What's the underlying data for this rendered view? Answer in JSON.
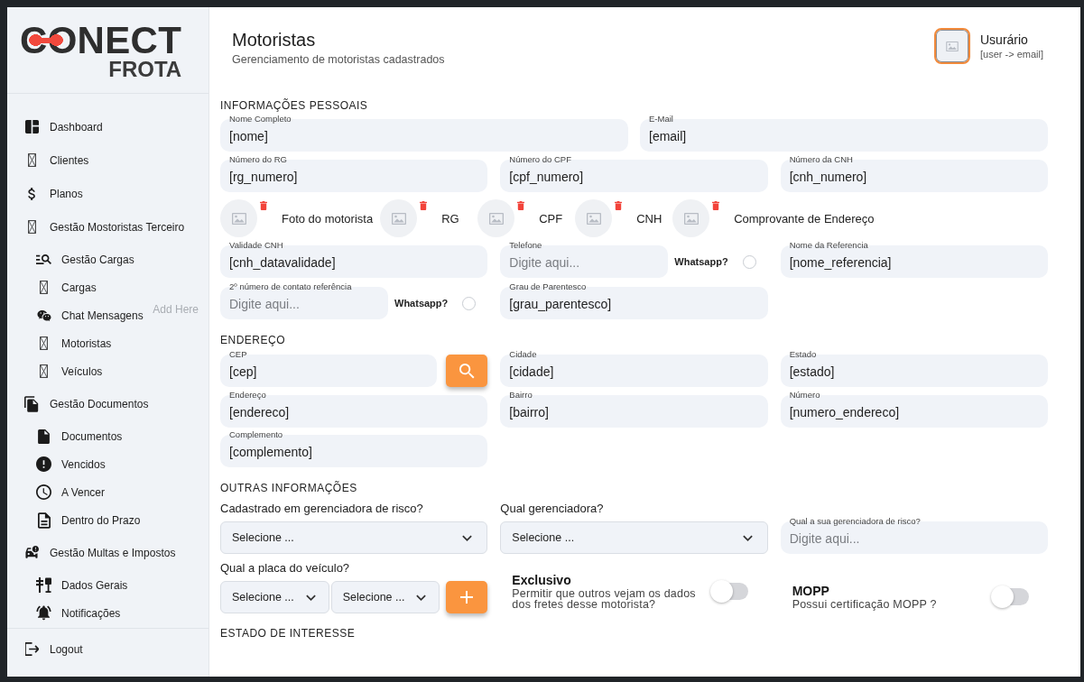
{
  "sidebar": {
    "logo": {
      "wordmark": "CONECT",
      "tagline": "FROTA"
    },
    "menu": [
      {
        "label": "Dashboard"
      },
      {
        "label": "Clientes"
      },
      {
        "label": "Planos"
      },
      {
        "label": "Gestão Mostoristas Terceiro",
        "children": [
          {
            "label": "Gestão Cargas"
          },
          {
            "label": "Cargas"
          },
          {
            "label": "Chat Mensagens",
            "note": "Add Here"
          },
          {
            "label": "Motoristas"
          },
          {
            "label": "Veículos"
          }
        ]
      },
      {
        "label": "Gestão Documentos",
        "children": [
          {
            "label": "Documentos"
          },
          {
            "label": "Vencidos"
          },
          {
            "label": "A Vencer"
          },
          {
            "label": "Dentro do Prazo"
          }
        ]
      },
      {
        "label": "Gestão Multas e Impostos",
        "children": [
          {
            "label": "Dados Gerais"
          },
          {
            "label": "Notificações"
          }
        ]
      }
    ],
    "logout": "Logout"
  },
  "header": {
    "title": "Motoristas",
    "subtitle": "Gerenciamento de motoristas cadastrados",
    "user": {
      "name": "Usurário",
      "email": "[user -> email]"
    }
  },
  "personal": {
    "heading": "INFORMAÇÕES PESSOAIS",
    "name_fields": [
      {
        "label": "Nome Completo",
        "value": "[nome]"
      },
      {
        "label": "E-Mail",
        "value": "[email]"
      }
    ],
    "id_fields": [
      {
        "label": "Número do RG",
        "value": "[rg_numero]"
      },
      {
        "label": "Número do CPF",
        "value": "[cpf_numero]"
      },
      {
        "label": "Número da CNH",
        "value": "[cnh_numero]"
      }
    ],
    "documents": [
      {
        "label": "Foto do motorista"
      },
      {
        "label": "RG"
      },
      {
        "label": "CPF"
      },
      {
        "label": "CNH"
      },
      {
        "label": "Comprovante de Endereço"
      }
    ],
    "validity": {
      "label": "Validade CNH",
      "value": "[cnh_datavalidade]"
    },
    "phone": {
      "label": "Telefone",
      "placeholder": "Digite aqui...",
      "whatsapp": {
        "label": "Whatsapp?",
        "checked": false
      }
    },
    "reference_name": {
      "label": "Nome da Referencia",
      "value": "[nome_referencia]"
    },
    "reference_phone": {
      "label": "2º número de contato referência",
      "placeholder": "Digite aqui...",
      "whatsapp": {
        "label": "Whatsapp?",
        "checked": false
      }
    },
    "kinship": {
      "label": "Grau de Parentesco",
      "value": "[grau_parentesco]"
    }
  },
  "address": {
    "heading": "ENDEREÇO",
    "cep": {
      "label": "CEP",
      "value": "[cep]"
    },
    "fields": [
      {
        "label": "Cidade",
        "value": "[cidade]"
      },
      {
        "label": "Estado",
        "value": "[estado]"
      },
      {
        "label": "Endereço",
        "value": "[endereco]"
      },
      {
        "label": "Bairro",
        "value": "[bairro]"
      },
      {
        "label": "Número",
        "value": "[numero_endereco]"
      },
      {
        "label": "Complemento",
        "value": "[complemento]"
      }
    ]
  },
  "other": {
    "heading": "OUTRAS INFORMAÇÕES",
    "risk_registered": {
      "label": "Cadastrado em gerenciadora de risco?",
      "value": "Selecione ..."
    },
    "risk_manager": {
      "label": "Qual gerenciadora?",
      "value": "Selecione ..."
    },
    "risk_manager_name": {
      "label": "Qual a sua gerenciadora de risco?",
      "placeholder": "Digite aqui..."
    },
    "plate": {
      "label": "Qual a placa do veículo?",
      "selects": [
        "Selecione ...",
        "Selecione ..."
      ]
    },
    "toggles": [
      {
        "title": "Exclusivo",
        "description": "Permitir que outros vejam os dados dos fretes desse motorista?",
        "on": false
      },
      {
        "title": "MOPP",
        "description": "Possui certificação MOPP ?",
        "on": false
      }
    ]
  },
  "interest": {
    "heading": "ESTADO DE INTERESSE"
  }
}
